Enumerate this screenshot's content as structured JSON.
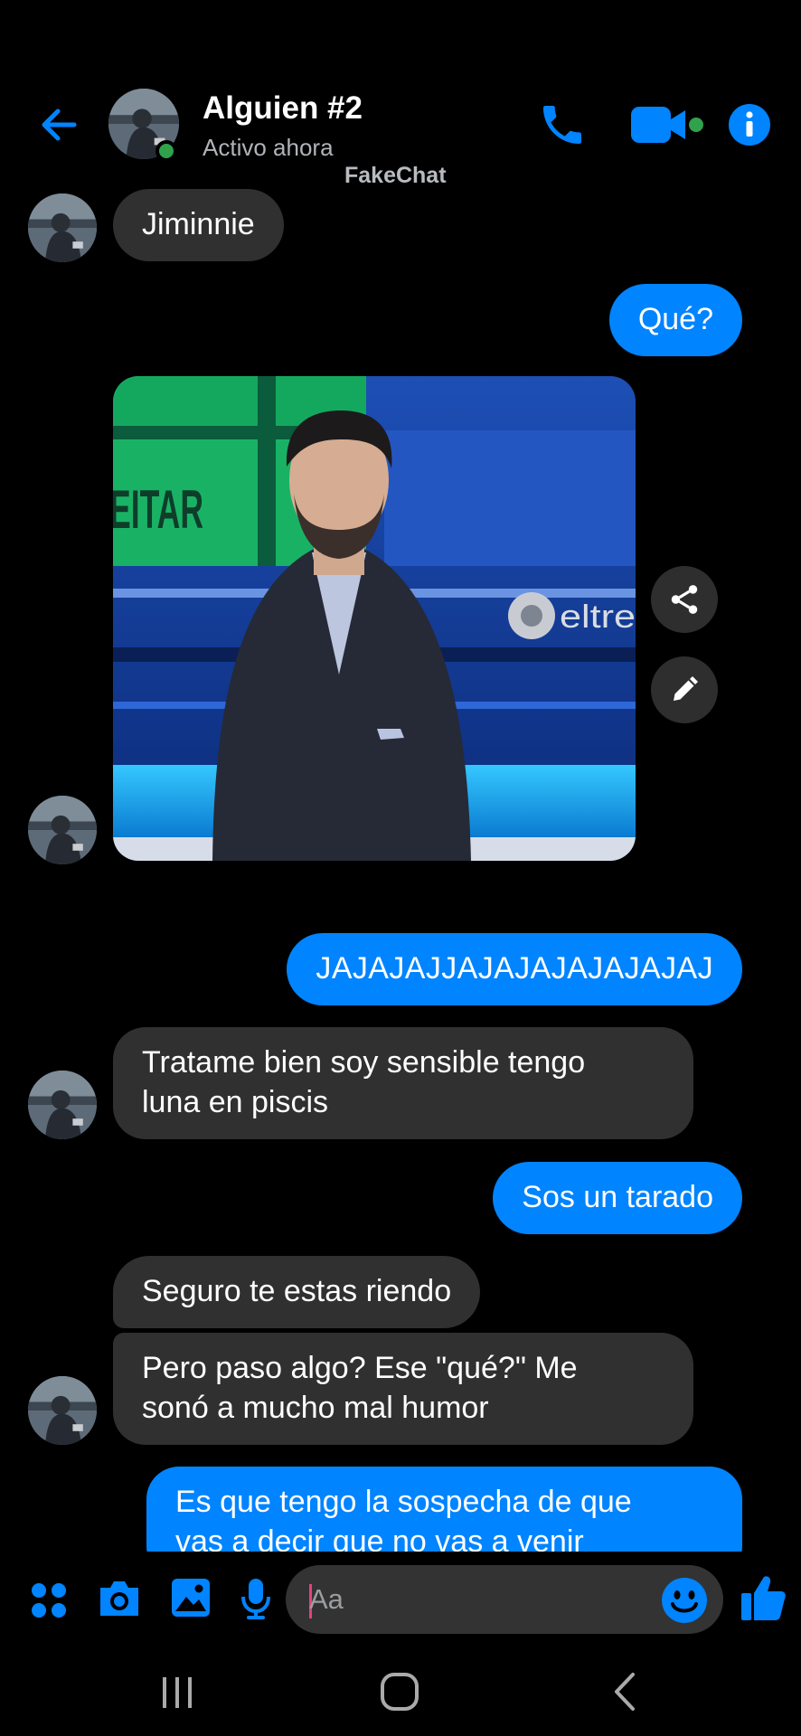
{
  "header": {
    "contact_name": "Alguien #2",
    "status": "Activo ahora",
    "watermark": "FakeChat",
    "icons": [
      "back-arrow-icon",
      "phone-icon",
      "video-camera-icon",
      "info-icon"
    ]
  },
  "messages": [
    {
      "from": "them",
      "text": "Jiminnie"
    },
    {
      "from": "me",
      "text": "Qué?"
    },
    {
      "from": "them",
      "type": "image",
      "image_overlay_text": [
        "EITAR",
        "eltre"
      ]
    },
    {
      "from": "me",
      "text": "JAJAJAJJAJAJAJAJAJAJAJ"
    },
    {
      "from": "them",
      "lines": [
        "Tratame bien soy sensible tengo",
        "luna en piscis"
      ]
    },
    {
      "from": "me",
      "text": "Sos un tarado"
    },
    {
      "from": "them",
      "text": "Seguro te estas riendo"
    },
    {
      "from": "them",
      "lines": [
        "Pero paso algo? Ese \"qué?\" Me",
        "sonó a mucho mal humor"
      ]
    },
    {
      "from": "me",
      "lines": [
        "Es que tengo la sospecha de que",
        "vas a decir que no vas a venir"
      ]
    }
  ],
  "image_actions": [
    "share-icon",
    "edit-icon"
  ],
  "composer": {
    "placeholder": "Aa",
    "icons": [
      "apps-grid-icon",
      "camera-icon",
      "gallery-icon",
      "microphone-icon",
      "emoji-icon",
      "thumbs-up-icon"
    ]
  },
  "system_nav": [
    "recents-icon",
    "home-icon",
    "back-icon"
  ],
  "colors": {
    "background": "#000000",
    "accent": "#0084ff",
    "incoming_bubble": "#303030",
    "online": "#31a24c",
    "subtext": "#b0b3b8"
  }
}
